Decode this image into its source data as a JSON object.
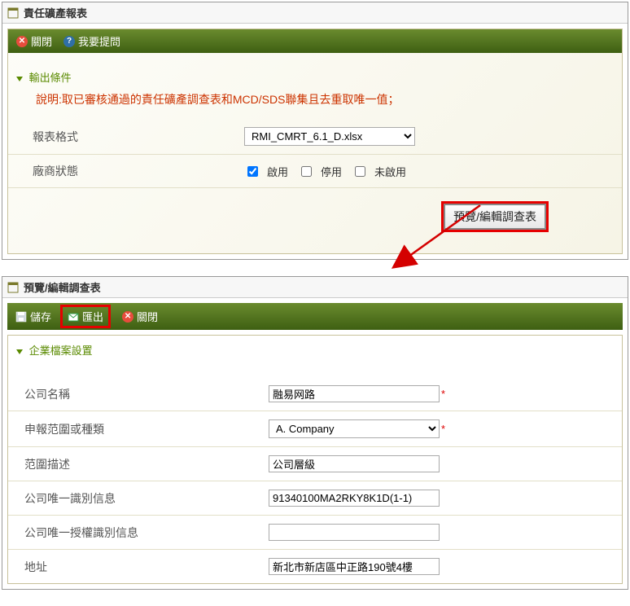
{
  "panel1": {
    "title": "責任礦產報表",
    "toolbar": {
      "close": "關閉",
      "ask": "我要提問"
    },
    "group_title": "輸出條件",
    "instruction": "說明:取已審核通過的責任礦產調查表和MCD/SDS聯集且去重取唯一值；",
    "rows": {
      "format_label": "報表格式",
      "format_value": "RMI_CMRT_6.1_D.xlsx",
      "status_label": "廠商狀態",
      "status_options": {
        "enable": "啟用",
        "disable": "停用",
        "not_enable": "未啟用"
      }
    },
    "preview_btn": "預覽/編輯調查表"
  },
  "panel2": {
    "title": "預覽/編輯調查表",
    "toolbar": {
      "save": "儲存",
      "export": "匯出",
      "close": "關閉"
    },
    "group_title": "企業檔案設置",
    "form": {
      "company_name_label": "公司名稱",
      "company_name_value": "融易网路",
      "scope_type_label": "申報范圍或種類",
      "scope_type_value": "A. Company",
      "scope_desc_label": "范圍描述",
      "scope_desc_value": "公司層級",
      "company_id_label": "公司唯一識別信息",
      "company_id_value": "91340100MA2RKY8K1D(1-1)",
      "auth_id_label": "公司唯一授權識別信息",
      "auth_id_value": "",
      "address_label": "地址",
      "address_value": "新北市新店區中正路190號4樓"
    }
  }
}
